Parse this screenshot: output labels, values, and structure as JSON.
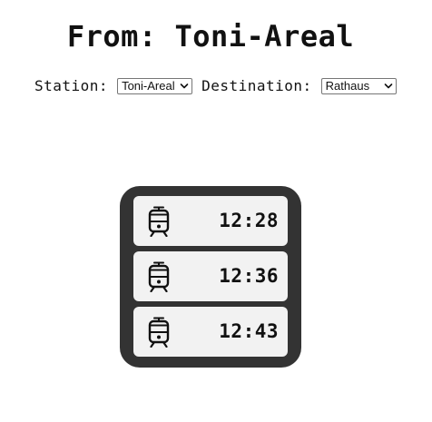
{
  "header": {
    "title": "From: Toni-Areal"
  },
  "controls": {
    "station_label": "Station:",
    "station_selected": "Toni-Areal",
    "destination_label": "Destination:",
    "destination_selected": "Rathaus"
  },
  "departures": [
    {
      "icon": "tram-icon",
      "time": "12:28"
    },
    {
      "icon": "tram-icon",
      "time": "12:36"
    },
    {
      "icon": "tram-icon",
      "time": "12:43"
    }
  ],
  "colors": {
    "board_background": "#333333",
    "row_background": "#f2f2f2",
    "text": "#111111"
  }
}
